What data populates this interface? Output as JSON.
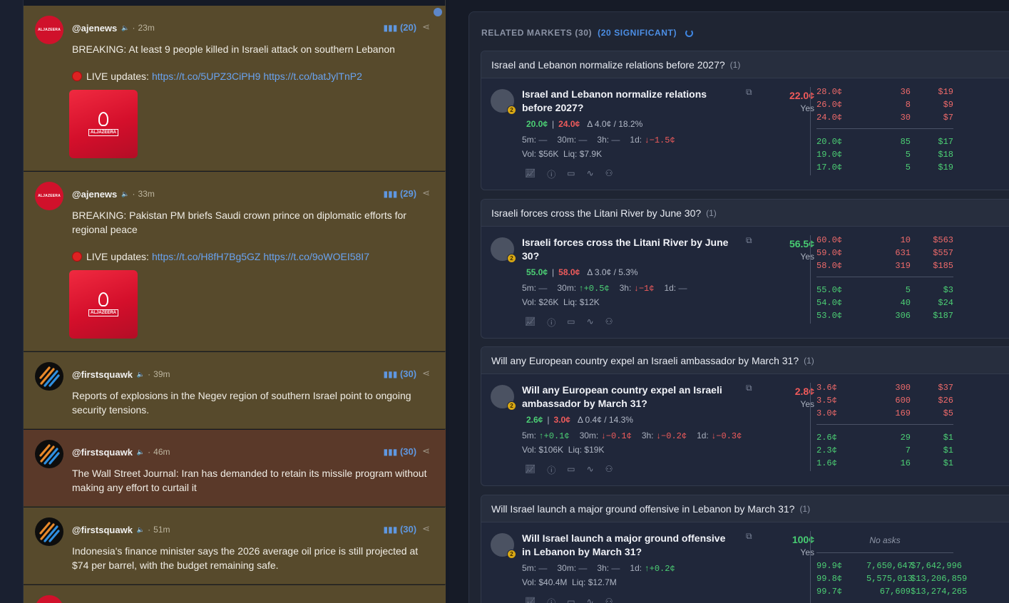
{
  "feed": {
    "tweets": [
      {
        "handle": "@ajenews",
        "age": "23m",
        "count": "(20)",
        "text": "BREAKING: At least 9 people killed in Israeli attack on southern Lebanon",
        "live_label": "LIVE updates:",
        "links": "https://t.co/5UPZ3CiPH9 https://t.co/batJylTnP2",
        "avatar_text": "ALJAZEERA",
        "thumb_text": "ALJAZEERA"
      },
      {
        "handle": "@ajenews",
        "age": "33m",
        "count": "(29)",
        "text": "BREAKING: Pakistan PM briefs Saudi crown prince on diplomatic efforts for regional peace",
        "live_label": "LIVE updates:",
        "links": "https://t.co/H8fH7Bg5GZ https://t.co/9oWOEI58I7",
        "avatar_text": "ALJAZEERA",
        "thumb_text": "ALJAZEERA"
      },
      {
        "handle": "@firstsquawk",
        "age": "39m",
        "count": "(30)",
        "text": "Reports of explosions in the Negev region of southern Israel point to ongoing security tensions."
      },
      {
        "handle": "@firstsquawk",
        "age": "46m",
        "count": "(30)",
        "text": "The Wall Street Journal: Iran has demanded to retain its missile program without making any effort to curtail it"
      },
      {
        "handle": "@firstsquawk",
        "age": "51m",
        "count": "(30)",
        "text": "Indonesia's finance minister says the 2026 average oil price is still projected at $74 per barrel, with the budget remaining safe."
      }
    ],
    "separator": "·"
  },
  "panel": {
    "title": "RELATED MARKETS (30)",
    "significant": "(20 SIGNIFICANT)",
    "markets": [
      {
        "group_title": "Israel and Lebanon normalize relations before 2027?",
        "group_count": "(1)",
        "question": "Israel and Lebanon normalize relations before 2027?",
        "badge": "2",
        "bid": "20.0¢",
        "ask": "24.0¢",
        "delta": "Δ 4.0¢ / 18.2%",
        "changes": [
          {
            "label": "5m:",
            "val": "—",
            "dir": "nil"
          },
          {
            "label": "30m:",
            "val": "—",
            "dir": "nil"
          },
          {
            "label": "3h:",
            "val": "—",
            "dir": "nil"
          },
          {
            "label": "1d:",
            "val": "↓−1.5¢",
            "dir": "dn"
          }
        ],
        "vol": "Vol: $56K  Liq: $7.9K",
        "price": "22.0¢",
        "price_color": "red",
        "outcome": "Yes",
        "asks": [
          [
            "28.0¢",
            "36",
            "$19"
          ],
          [
            "26.0¢",
            "8",
            "$9"
          ],
          [
            "24.0¢",
            "30",
            "$7"
          ]
        ],
        "bids": [
          [
            "20.0¢",
            "85",
            "$17"
          ],
          [
            "19.0¢",
            "5",
            "$18"
          ],
          [
            "17.0¢",
            "5",
            "$19"
          ]
        ]
      },
      {
        "group_title": "Israeli forces cross the Litani River by June 30?",
        "group_count": "(1)",
        "question": "Israeli forces cross the Litani River by June 30?",
        "badge": "2",
        "bid": "55.0¢",
        "ask": "58.0¢",
        "delta": "Δ 3.0¢ / 5.3%",
        "changes": [
          {
            "label": "5m:",
            "val": "—",
            "dir": "nil"
          },
          {
            "label": "30m:",
            "val": "↑+0.5¢",
            "dir": "up"
          },
          {
            "label": "3h:",
            "val": "↓−1¢",
            "dir": "dn"
          },
          {
            "label": "1d:",
            "val": "—",
            "dir": "nil"
          }
        ],
        "vol": "Vol: $26K  Liq: $12K",
        "price": "56.5¢",
        "price_color": "green",
        "outcome": "Yes",
        "asks": [
          [
            "60.0¢",
            "10",
            "$563"
          ],
          [
            "59.0¢",
            "631",
            "$557"
          ],
          [
            "58.0¢",
            "319",
            "$185"
          ]
        ],
        "bids": [
          [
            "55.0¢",
            "5",
            "$3"
          ],
          [
            "54.0¢",
            "40",
            "$24"
          ],
          [
            "53.0¢",
            "306",
            "$187"
          ]
        ]
      },
      {
        "group_title": "Will any European country expel an Israeli ambassador by March 31?",
        "group_count": "(1)",
        "question": "Will any European country expel an Israeli ambassador by March 31?",
        "badge": "2",
        "bid": "2.6¢",
        "ask": "3.0¢",
        "delta": "Δ 0.4¢ / 14.3%",
        "changes": [
          {
            "label": "5m:",
            "val": "↑+0.1¢",
            "dir": "up"
          },
          {
            "label": "30m:",
            "val": "↓−0.1¢",
            "dir": "dn"
          },
          {
            "label": "3h:",
            "val": "↓−0.2¢",
            "dir": "dn"
          },
          {
            "label": "1d:",
            "val": "↓−0.3¢",
            "dir": "dn"
          }
        ],
        "vol": "Vol: $106K  Liq: $19K",
        "price": "2.8¢",
        "price_color": "red",
        "outcome": "Yes",
        "asks": [
          [
            "3.6¢",
            "300",
            "$37"
          ],
          [
            "3.5¢",
            "600",
            "$26"
          ],
          [
            "3.0¢",
            "169",
            "$5"
          ]
        ],
        "bids": [
          [
            "2.6¢",
            "29",
            "$1"
          ],
          [
            "2.3¢",
            "7",
            "$1"
          ],
          [
            "1.6¢",
            "16",
            "$1"
          ]
        ]
      },
      {
        "group_title": "Will Israel launch a major ground offensive in Lebanon by March 31?",
        "group_count": "(1)",
        "question": "Will Israel launch a major ground offensive in Lebanon by March 31?",
        "badge": "2",
        "changes": [
          {
            "label": "5m:",
            "val": "—",
            "dir": "nil"
          },
          {
            "label": "30m:",
            "val": "—",
            "dir": "nil"
          },
          {
            "label": "3h:",
            "val": "—",
            "dir": "nil"
          },
          {
            "label": "1d:",
            "val": "↑+0.2¢",
            "dir": "up"
          }
        ],
        "vol": "Vol: $40.4M  Liq: $12.7M",
        "price": "100¢",
        "price_color": "green",
        "outcome": "Yes",
        "no_asks": "No asks",
        "bids": [
          [
            "99.9¢",
            "7,650,647",
            "$7,642,996"
          ],
          [
            "99.8¢",
            "5,575,013",
            "$13,206,859"
          ],
          [
            "99.7¢",
            "67,609",
            "$13,274,265"
          ]
        ]
      }
    ]
  },
  "icons": [
    "speaker-icon",
    "bar-chart-icon",
    "share-icon",
    "external-link-icon",
    "chart-icon",
    "info-icon",
    "comment-icon",
    "activity-icon",
    "users-icon",
    "spinner-icon"
  ],
  "colors": {
    "tweet_bg": "#574a2c",
    "tweet_highlight_bg": "#5a3929",
    "link": "#6aa3ef",
    "ask_red": "#ee5b5b",
    "bid_green": "#4ccf74",
    "accent_blue": "#4c8fe6"
  }
}
